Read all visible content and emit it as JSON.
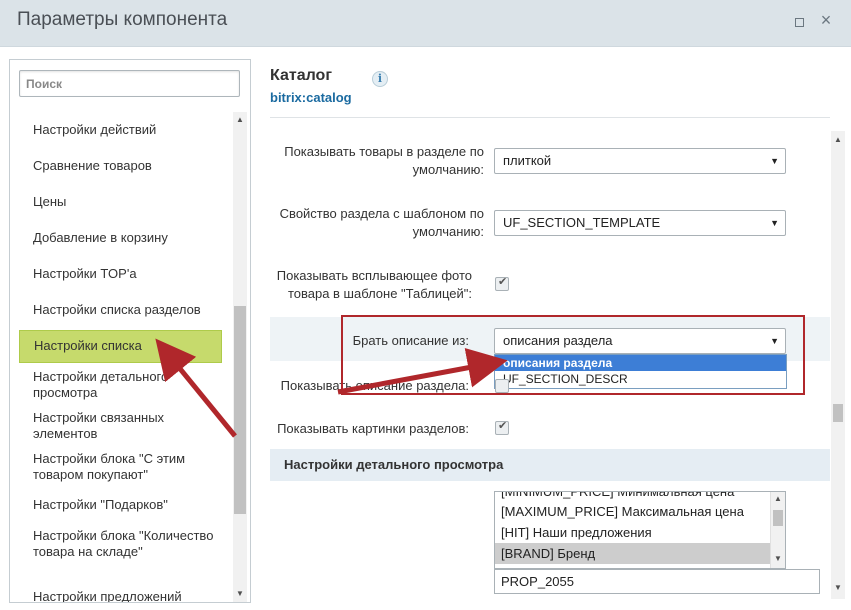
{
  "window": {
    "title": "Параметры компонента",
    "maximize_icon": "maximize-icon",
    "close_icon": "close-icon"
  },
  "sidebar": {
    "search_placeholder": "Поиск",
    "items": [
      {
        "label": "Настройки действий"
      },
      {
        "label": "Сравнение товаров"
      },
      {
        "label": "Цены"
      },
      {
        "label": "Добавление в корзину"
      },
      {
        "label": "Настройки TOP'a"
      },
      {
        "label": "Настройки списка разделов"
      },
      {
        "label": "Настройки списка",
        "active": true
      },
      {
        "label": "Настройки детального просмотра"
      },
      {
        "label": "Настройки связанных элементов"
      },
      {
        "label": "Настройки блока \"С этим товаром покупают\""
      },
      {
        "label": "Настройки \"Подарков\""
      },
      {
        "label": "Настройки блока \"Количество товара на складе\""
      },
      {
        "label": "Настройки предложений"
      }
    ],
    "active_color": "#c6da6c"
  },
  "component": {
    "title": "Каталог",
    "code": "bitrix:catalog",
    "info_icon": "info-icon"
  },
  "params": {
    "show_items_label": "Показывать товары в разделе по умолчанию:",
    "show_items_value": "плиткой",
    "section_template_label": "Свойство раздела с шаблоном по умолчанию:",
    "section_template_value": "UF_SECTION_TEMPLATE",
    "popup_photo_label": "Показывать всплывающее фото товара в шаблоне \"Таблицей\":",
    "popup_photo_checked": true,
    "description_from_label": "Брать описание из:",
    "description_from_value": "описания раздела",
    "description_from_options": [
      "описания раздела",
      "UF_SECTION_DESCR"
    ],
    "show_section_desc_label": "Показывать описание раздела:",
    "show_section_pictures_label": "Показывать картинки разделов:",
    "show_section_pictures_checked": true
  },
  "detail_section": {
    "header": "Настройки детального просмотра",
    "list_options": [
      {
        "label": "[MINIMUM_PRICE] Минимальная цена"
      },
      {
        "label": "[MAXIMUM_PRICE] Максимальная цена"
      },
      {
        "label": "[HIT] Наши предложения"
      },
      {
        "label": "[BRAND] Бренд",
        "selected": true
      }
    ],
    "text_value": "PROP_2055"
  },
  "annotation": {
    "highlight_color": "#b0272b"
  }
}
